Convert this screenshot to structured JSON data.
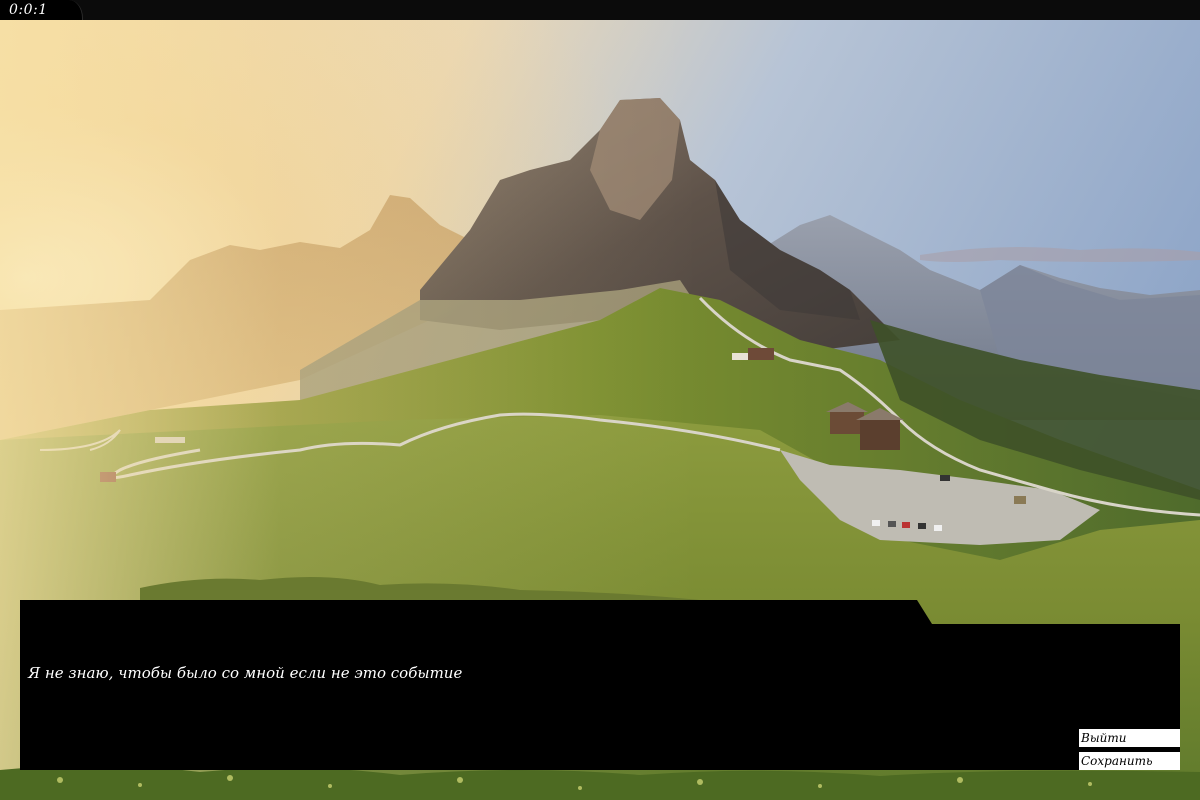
{
  "hud": {
    "timer": "0:0:1"
  },
  "scene": {
    "description_icon": "mountain-landscape-background"
  },
  "dialog": {
    "text": "Я не знаю, чтобы было со мной если не это событие"
  },
  "menu": {
    "exit_label": "Выйти",
    "save_label": "Сохранить"
  },
  "colors": {
    "dialog_bg": "#000000",
    "button_bg": "#ffffff",
    "button_text": "#000000",
    "dialog_text": "#ffffff"
  }
}
